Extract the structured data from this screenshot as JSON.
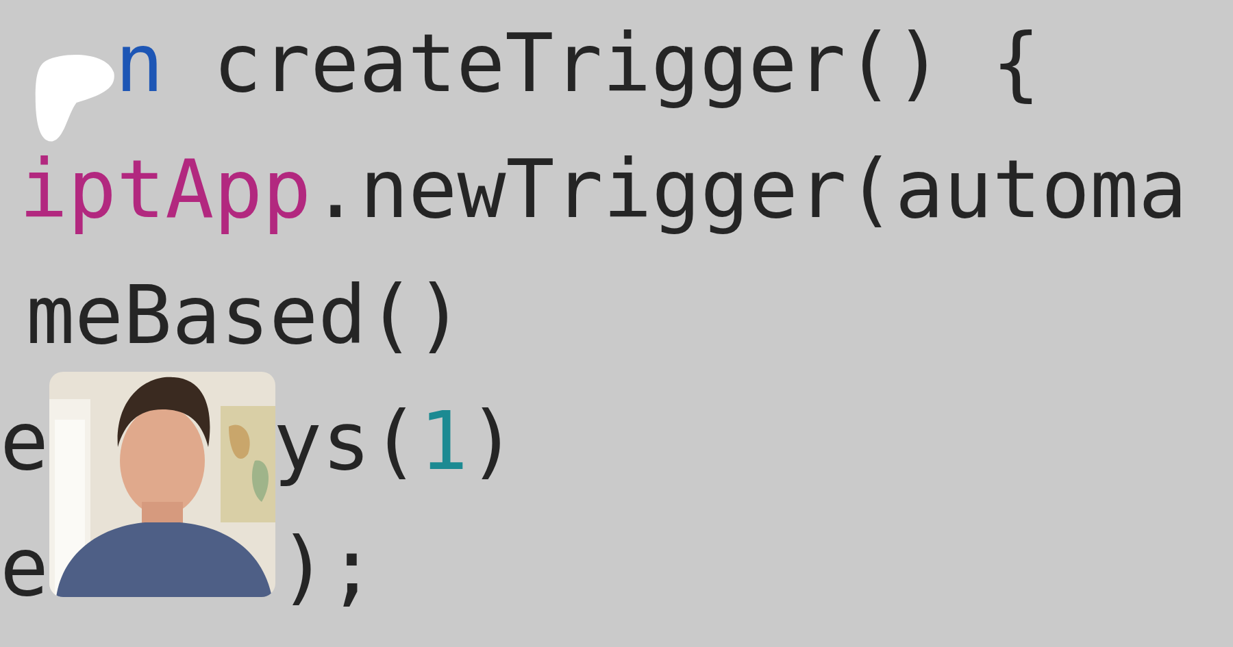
{
  "code_lines": [
    [
      {
        "text": "n",
        "kind": "keyword"
      },
      {
        "text": "createTrigger() {",
        "kind": "plain"
      }
    ],
    [
      {
        "text": "iptApp",
        "kind": "class"
      },
      {
        "text": ".newTrigger(automa",
        "kind": "plain"
      }
    ],
    [
      {
        "text": "meBased()",
        "kind": "plain"
      }
    ],
    [
      {
        "text": "e",
        "kind": "plain"
      },
      {
        "text": "ys(",
        "kind": "plain"
      },
      {
        "text": "1",
        "kind": "number"
      },
      {
        "text": ")",
        "kind": "plain"
      }
    ],
    [
      {
        "text": "e",
        "kind": "plain"
      },
      {
        "text": ");",
        "kind": "plain"
      }
    ]
  ],
  "webcam": {
    "kind": "picture"
  }
}
